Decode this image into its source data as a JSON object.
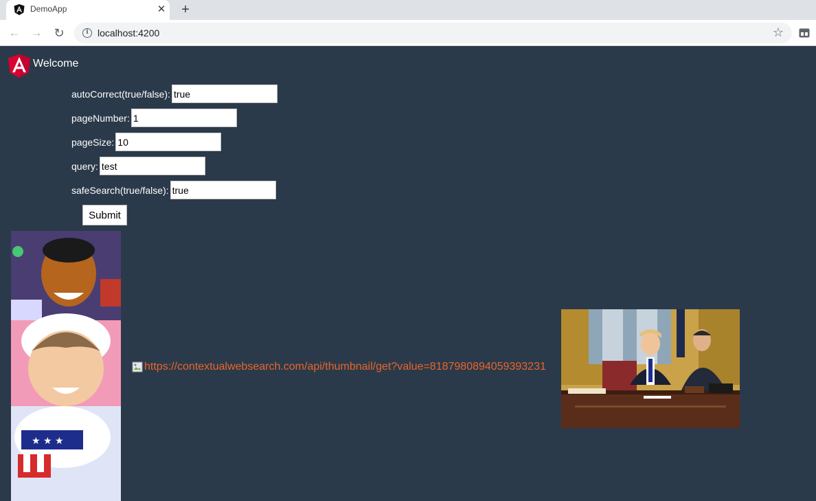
{
  "browser": {
    "tab_title": "DemoApp",
    "url": "localhost:4200"
  },
  "app": {
    "welcome": "Welcome"
  },
  "form": {
    "fields": [
      {
        "label": "autoCorrect(true/false):",
        "value": "true"
      },
      {
        "label": "pageNumber:",
        "value": "1"
      },
      {
        "label": "pageSize:",
        "value": "10"
      },
      {
        "label": "query:",
        "value": "test"
      },
      {
        "label": "safeSearch(true/false):",
        "value": "true"
      }
    ],
    "submit_label": "Submit"
  },
  "results": {
    "broken_image_alt": "https://contextualwebsearch.com/api/thumbnail/get?value=8187980894059393231"
  },
  "colors": {
    "page_bg": "#2b3a4a",
    "link": "#e8652b",
    "angular_red": "#dd0031"
  }
}
